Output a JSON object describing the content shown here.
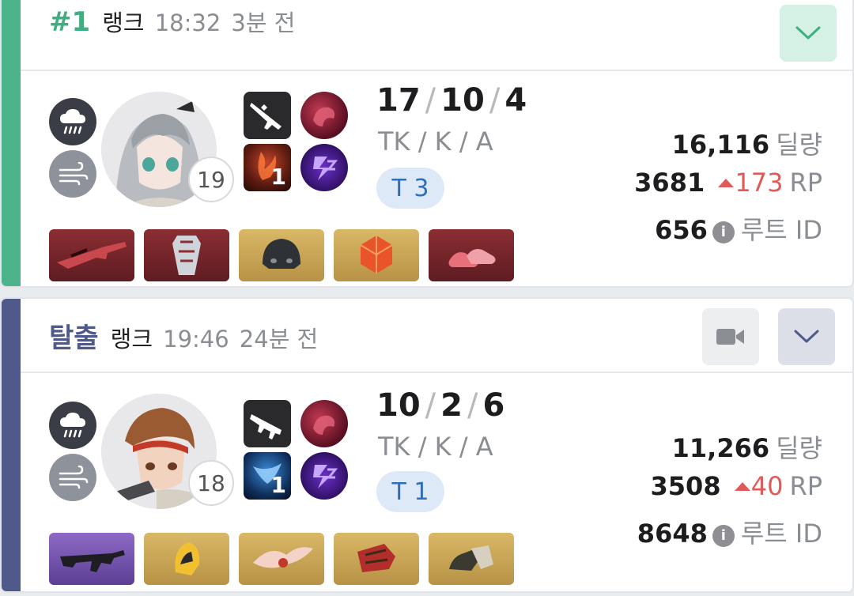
{
  "matches": [
    {
      "rank": "#1",
      "mode": "랭크",
      "time": "18:32",
      "ago": "3분 전",
      "accent_color": "#4db38a",
      "level": "19",
      "kda": {
        "tk": "17",
        "k": "10",
        "a": "4"
      },
      "kda_label": "TK / K / A",
      "tier": "T 3",
      "damage": "16,116",
      "damage_unit": "딜량",
      "rp": "3681",
      "rp_change": "173",
      "rp_unit": "RP",
      "route_id": "656",
      "route_label": "루트 ID",
      "skill_level": "1",
      "icons": [
        "rain-icon",
        "wind-icon",
        "sniper-rifle-icon"
      ],
      "items": [
        "sniper-rifle-item",
        "armor-item",
        "helmet-item",
        "dice-item",
        "shoes-item"
      ],
      "buttons": [
        "expand-button"
      ]
    },
    {
      "rank": "탈출",
      "mode": "랭크",
      "time": "19:46",
      "ago": "24분 전",
      "accent_color": "#4f5a8a",
      "level": "18",
      "kda": {
        "tk": "10",
        "k": "2",
        "a": "6"
      },
      "kda_label": "TK / K / A",
      "tier": "T 1",
      "damage": "11,266",
      "damage_unit": "딜량",
      "rp": "3508",
      "rp_change": "40",
      "rp_unit": "RP",
      "route_id": "8648",
      "route_label": "루트 ID",
      "skill_level": "1",
      "icons": [
        "rain-icon",
        "wind-icon",
        "assault-rifle-icon"
      ],
      "items": [
        "assault-rifle-item",
        "helmet-item",
        "wing-item",
        "gauntlet-item",
        "boots-item"
      ],
      "buttons": [
        "video-button",
        "expand-button"
      ]
    }
  ]
}
